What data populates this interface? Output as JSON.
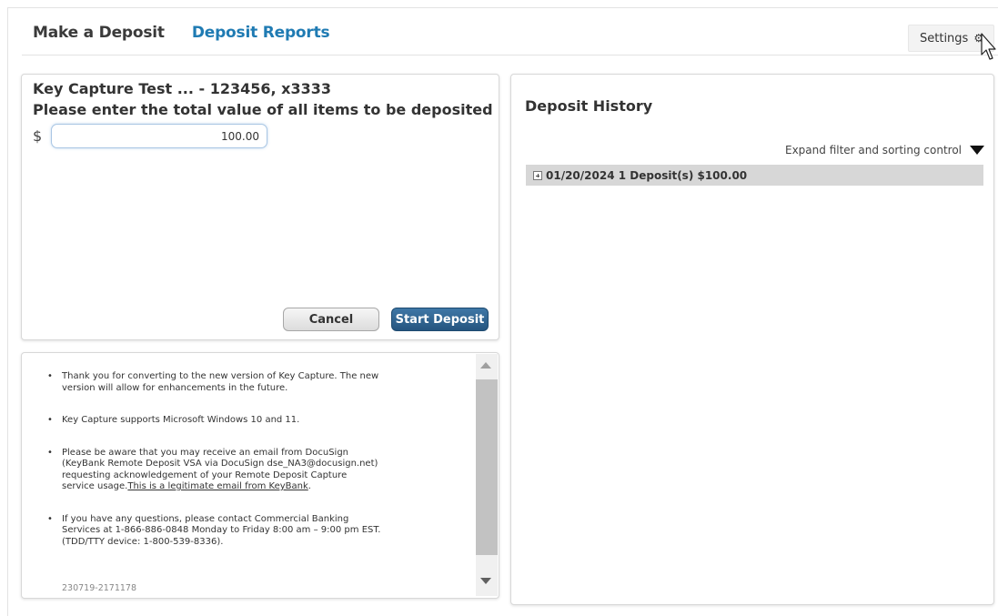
{
  "tabs": [
    {
      "label": "Make a Deposit",
      "active": false
    },
    {
      "label": "Deposit Reports",
      "active": true
    }
  ],
  "settings": {
    "label": "Settings",
    "icon": "gear-icon"
  },
  "deposit_form": {
    "account": "Key Capture Test ... - 123456, x3333",
    "instruction": "Please enter the total value of all items to be deposited",
    "currency_symbol": "$",
    "amount_value": "100.00",
    "cancel_label": "Cancel",
    "start_label": "Start Deposit"
  },
  "notices": {
    "items": [
      {
        "text": "Thank you for converting to the new version of Key Capture. The new version will allow for enhancements in the future."
      },
      {
        "text": "Key Capture supports Microsoft Windows 10 and 11."
      },
      {
        "text": "Please be aware that you may receive an email from DocuSign (KeyBank Remote Deposit VSA via DocuSign dse_NA3@docusign.net) requesting acknowledgement of your Remote Deposit Capture service usage.",
        "link": "This is a legitimate email from KeyBank",
        "suffix": "."
      },
      {
        "text": "If you have any questions, please contact Commercial Banking Services at 1-866-886-0848 Monday to Friday 8:00 am – 9:00 pm EST. (TDD/TTY device: 1-800-539-8336)."
      }
    ],
    "version": "230719-2171178"
  },
  "history": {
    "title": "Deposit History",
    "filter_label": "Expand filter and sorting control",
    "entries": [
      {
        "text": "01/20/2024 1 Deposit(s) $100.00"
      }
    ]
  },
  "colors": {
    "accent": "#1f7bb3",
    "primary_button": "#2f6591",
    "row_bg": "#d7d7d7"
  }
}
